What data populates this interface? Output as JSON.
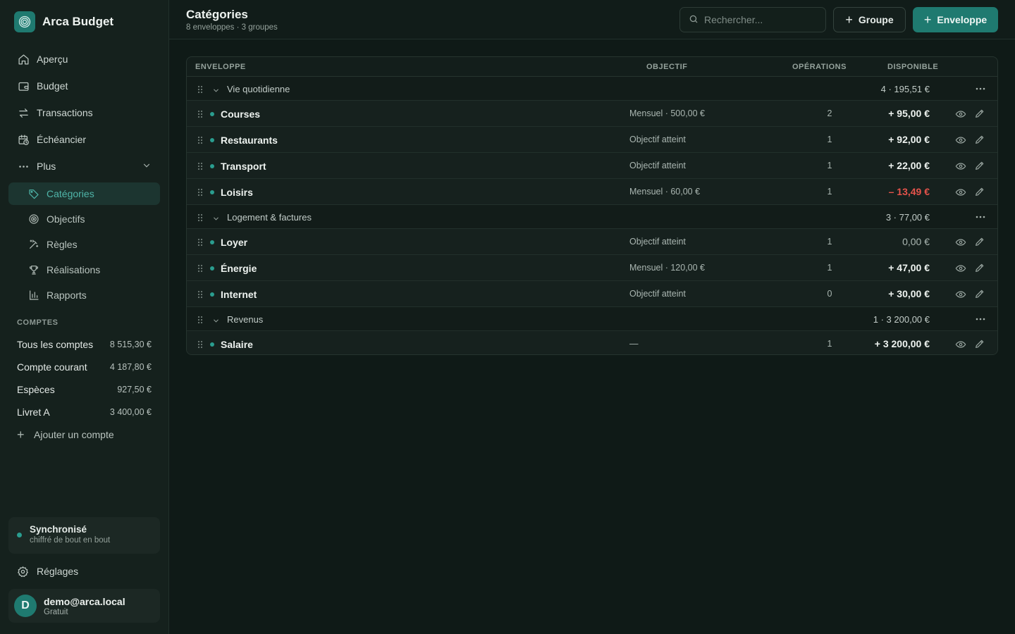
{
  "app": {
    "name": "Arca Budget"
  },
  "nav": {
    "items": [
      {
        "label": "Aperçu",
        "icon": "home-icon"
      },
      {
        "label": "Budget",
        "icon": "wallet-icon"
      },
      {
        "label": "Transactions",
        "icon": "arrows-icon"
      },
      {
        "label": "Échéancier",
        "icon": "calendar-clock-icon"
      },
      {
        "label": "Plus",
        "icon": "more-icon"
      }
    ],
    "sub_items": [
      {
        "label": "Catégories",
        "icon": "tag-icon",
        "active": true
      },
      {
        "label": "Objectifs",
        "icon": "target-icon",
        "active": false
      },
      {
        "label": "Règles",
        "icon": "magic-wand-icon",
        "active": false
      },
      {
        "label": "Réalisations",
        "icon": "trophy-icon",
        "active": false
      },
      {
        "label": "Rapports",
        "icon": "bar-chart-icon",
        "active": false
      }
    ]
  },
  "accounts": {
    "title": "COMPTES",
    "rows": [
      {
        "name": "Tous les comptes",
        "balance": "8 515,30 €"
      },
      {
        "name": "Compte courant",
        "balance": "4 187,80 €"
      },
      {
        "name": "Espèces",
        "balance": "927,50 €"
      },
      {
        "name": "Livret A",
        "balance": "3 400,00 €"
      }
    ],
    "add_label": "Ajouter un compte"
  },
  "sync": {
    "title": "Synchronisé",
    "subtitle": "chiffré de bout en bout",
    "color": "#2a9d8f"
  },
  "settings": {
    "label": "Réglages"
  },
  "user": {
    "initial": "D",
    "email": "demo@arca.local",
    "plan": "Gratuit"
  },
  "header": {
    "title": "Catégories",
    "subtitle": "8 enveloppes · 3 groupes",
    "search_placeholder": "Rechercher...",
    "group_button": "Groupe",
    "envelope_button": "Enveloppe"
  },
  "table": {
    "columns": {
      "envelope": "ENVELOPPE",
      "goal": "OBJECTIF",
      "operations": "OPÉRATIONS",
      "available": "DISPONIBLE"
    },
    "groups": [
      {
        "name": "Vie quotidienne",
        "total": "4 · 195,51 €",
        "envelopes": [
          {
            "name": "Courses",
            "goal": "Mensuel · 500,00 €",
            "ops": "2",
            "available": "+ 95,00 €",
            "status": "positive"
          },
          {
            "name": "Restaurants",
            "goal": "Objectif atteint",
            "ops": "1",
            "available": "+ 92,00 €",
            "status": "positive"
          },
          {
            "name": "Transport",
            "goal": "Objectif atteint",
            "ops": "1",
            "available": "+ 22,00 €",
            "status": "positive"
          },
          {
            "name": "Loisirs",
            "goal": "Mensuel · 60,00 €",
            "ops": "1",
            "available": "– 13,49 €",
            "status": "negative"
          }
        ]
      },
      {
        "name": "Logement & factures",
        "total": "3 · 77,00 €",
        "envelopes": [
          {
            "name": "Loyer",
            "goal": "Objectif atteint",
            "ops": "1",
            "available": "0,00 €",
            "status": "zero"
          },
          {
            "name": "Énergie",
            "goal": "Mensuel · 120,00 €",
            "ops": "1",
            "available": "+ 47,00 €",
            "status": "positive"
          },
          {
            "name": "Internet",
            "goal": "Objectif atteint",
            "ops": "0",
            "available": "+ 30,00 €",
            "status": "positive"
          }
        ]
      },
      {
        "name": "Revenus",
        "total": "1 · 3 200,00 €",
        "envelopes": [
          {
            "name": "Salaire",
            "goal": "—",
            "ops": "1",
            "available": "+ 3 200,00 €",
            "status": "positive"
          }
        ]
      }
    ]
  },
  "colors": {
    "accent": "#1f7a70",
    "active_text": "#4fb5a9",
    "negative": "#e5534b"
  }
}
